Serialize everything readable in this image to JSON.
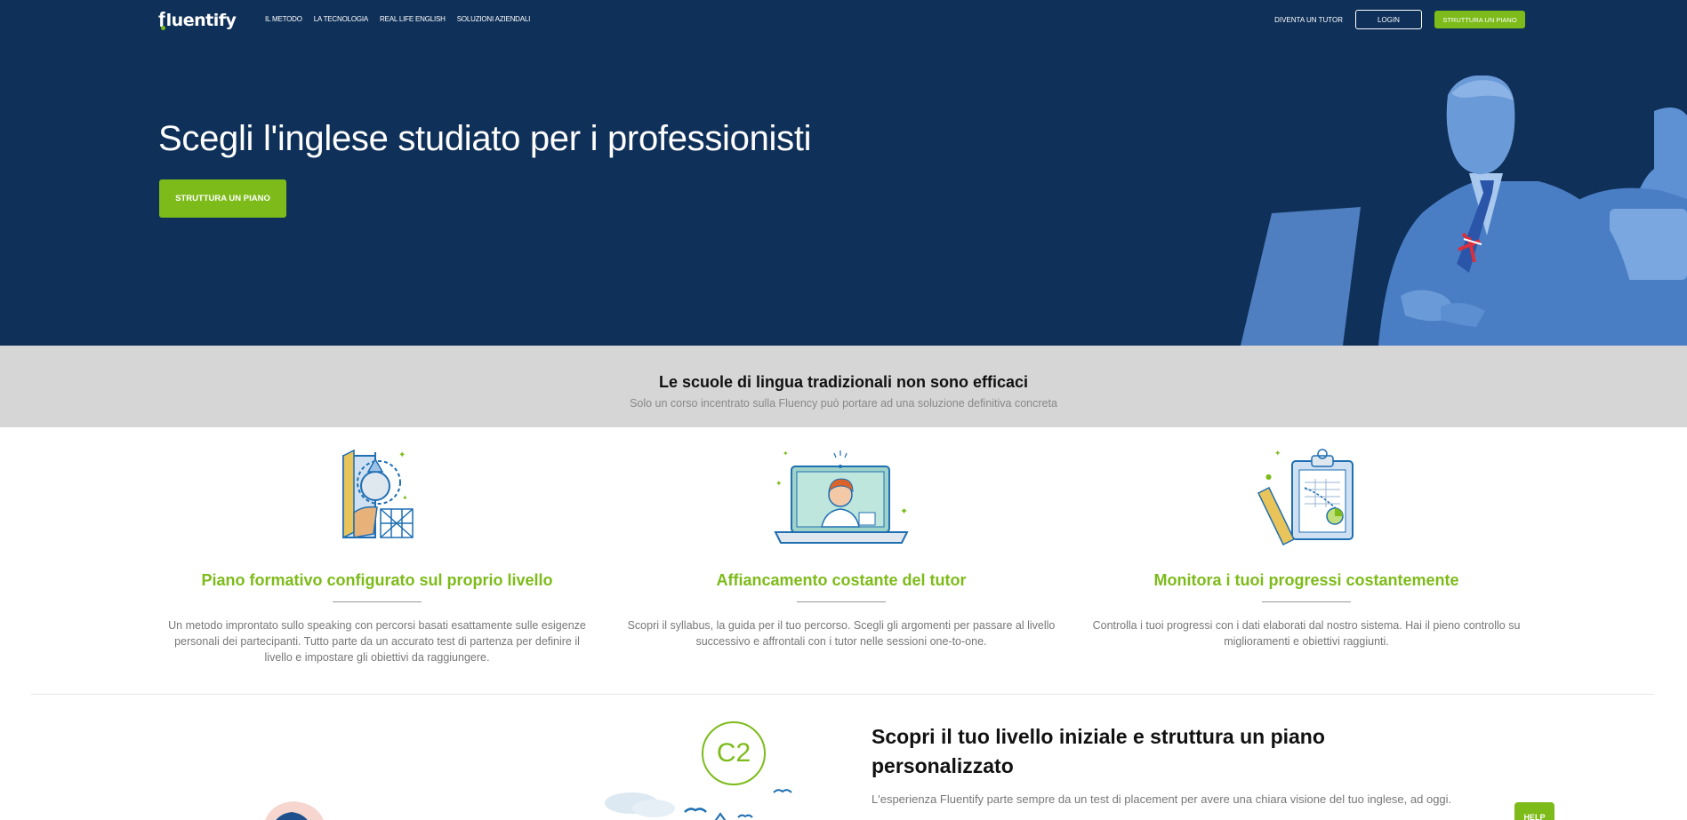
{
  "brand": {
    "logo_text": "fluentify",
    "logo_first": "f",
    "logo_rest": "luentify"
  },
  "nav": {
    "links": [
      "IL METODO",
      "LA TECNOLOGIA",
      "REAL LIFE ENGLISH",
      "SOLUZIONI AZIENDALI"
    ],
    "tutor": "DIVENTA UN TUTOR",
    "login": "LOGIN",
    "plan": "STRUTTURA UN PIANO"
  },
  "hero": {
    "title": "Scegli l'inglese studiato per i professionisti",
    "cta": "STRUTTURA UN PIANO"
  },
  "band": {
    "title": "Le scuole di lingua tradizionali non sono efficaci",
    "subtitle": "Solo un corso incentrato sulla Fluency può portare ad una soluzione definitiva concreta"
  },
  "features": [
    {
      "title": "Piano formativo configurato sul proprio livello",
      "text": "Un metodo improntato sullo speaking con percorsi basati esattamente sulle esigenze personali dei partecipanti. Tutto parte da un accurato test di partenza per definire il livello e impostare gli obiettivi da raggiungere."
    },
    {
      "title": "Affiancamento costante del tutor",
      "text": "Scopri il syllabus, la guida per il tuo percorso. Scegli gli argomenti per passare al livello successivo e affrontali con i tutor nelle sessioni one-to-one."
    },
    {
      "title": "Monitora i tuoi progressi costantemente",
      "text": "Controlla i tuoi progressi con i dati elaborati dal nostro sistema. Hai il pieno controllo su miglioramenti e obiettivi raggiunti."
    }
  ],
  "lower": {
    "badge": "C2",
    "title": "Scopri il tuo livello iniziale e struttura un piano personalizzato",
    "text": "L'esperienza Fluentify parte sempre da un test di placement per avere una chiara visione del tuo inglese, ad oggi.",
    "help": "HELP"
  },
  "colors": {
    "navy": "#0f3059",
    "green": "#7dbb1a",
    "band": "#d6d6d6",
    "figure_blue": "#5b8fd1"
  }
}
